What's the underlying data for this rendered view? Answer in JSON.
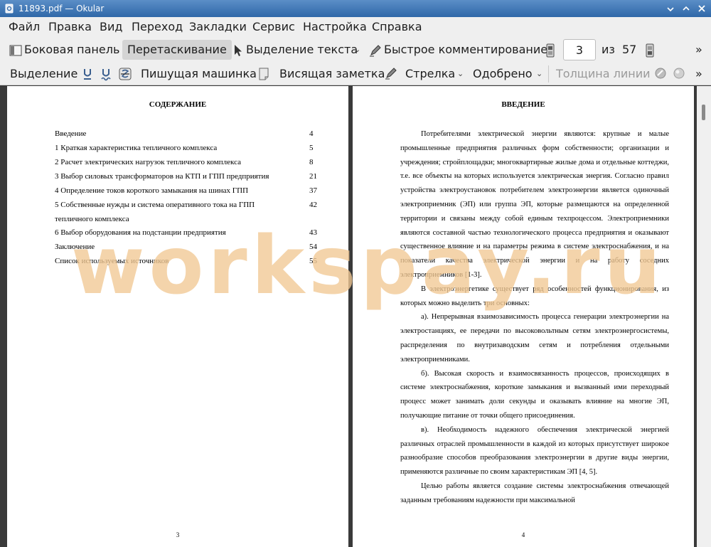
{
  "window": {
    "title": "11893.pdf — Okular",
    "controls": [
      "minimize-icon",
      "maximize-icon",
      "close-icon"
    ]
  },
  "menu": [
    "Файл",
    "Правка",
    "Вид",
    "Переход",
    "Закладки",
    "Сервис",
    "Настройка",
    "Справка"
  ],
  "toolbar1": {
    "sidebar": "Боковая панель",
    "drag": "Перетаскивание",
    "text_select": "Выделение текста",
    "quick_comment": "Быстрое комментирование",
    "current_page": "3",
    "of": "из",
    "total_pages": "57",
    "overflow": "»"
  },
  "toolbar2": {
    "highlight": "Выделение",
    "typewriter": "Пишущая машинка",
    "note": "Висящая заметка",
    "arrow": "Стрелка",
    "approved": "Одобрено",
    "line_width": "Толщина линии",
    "overflow": "»"
  },
  "page3": {
    "title": "СОДЕРЖАНИЕ",
    "toc": [
      {
        "label": "Введение",
        "page": "4"
      },
      {
        "label": "1 Краткая характеристика тепличного комплекса",
        "page": "5"
      },
      {
        "label": "2 Расчет электрических нагрузок тепличного комплекса",
        "page": "8"
      },
      {
        "label": "3 Выбор силовых трансформаторов на КТП и ГПП предприятия",
        "page": "21"
      },
      {
        "label": "4 Определение токов короткого замыкания на шинах ГПП",
        "page": "37"
      },
      {
        "label": "5 Собственные нужды и система оперативного тока на ГПП",
        "page": "42"
      },
      {
        "label": "тепличного комплекса",
        "page": ""
      },
      {
        "label": "6 Выбор оборудования на подстанции предприятия",
        "page": "43"
      },
      {
        "label": "Заключение",
        "page": "54"
      },
      {
        "label": "Список используемых источников",
        "page": "55"
      }
    ],
    "page_number": "3"
  },
  "page4": {
    "title": "ВВЕДЕНИЕ",
    "paragraphs": [
      "Потребителями электрической энергии являются: крупные и малые промышленные предприятия различных форм собственности; организации и учреждения; стройплощадки; многоквартирные жилые дома и отдельные коттеджи, т.е. все объекты на которых используется электрическая энергия. Согласно правил устройства электроустановок потребителем электроэнергии является одиночный электроприемник (ЭП) или группа ЭП, которые размещаются на определенной территории и связаны между собой единым техпроцессом. Электроприемники являются составной частью технологического процесса предприятия и оказывают существенное влияние и на параметры режима в системе электроснабжения, и на показатели качества электрической энергии и на работу соседних электроприемников [1-3].",
      "В электроэнергетике существует ряд особенностей функционирования, из которых можно выделить три основных:",
      "а). Непрерывная взаимозависимость процесса генерации электроэнергии на электростанциях, ее передачи по высоковольтным сетям электроэнергосистемы, распределения по внутризаводским сетям и потребления отдельными электроприемниками.",
      "б). Высокая скорость и взаимосвязанность процессов, происходящих в системе электроснабжения, короткие замыкания и вызванный ими переходный процесс может занимать доли секунды и оказывать влияние на многие ЭП, получающие питание от точки общего присоединения.",
      "в). Необходимость надежного обеспечения электрической энергией различных отраслей промышленности в каждой из которых присутствует широкое разнообразие способов преобразования электроэнергии в другие виды энергии, применяются различные по своим характеристикам ЭП [4, 5].",
      "Целью работы является создание системы электроснабжения отвечающей заданным требованиям надежности при максимальной"
    ],
    "page_number": "4"
  },
  "watermark": "workspay.ru",
  "colors": {
    "titlebar": "#3f77b6",
    "toolbar": "#efefef",
    "viewport": "#3a3a3a",
    "watermark": "#f2c994"
  }
}
